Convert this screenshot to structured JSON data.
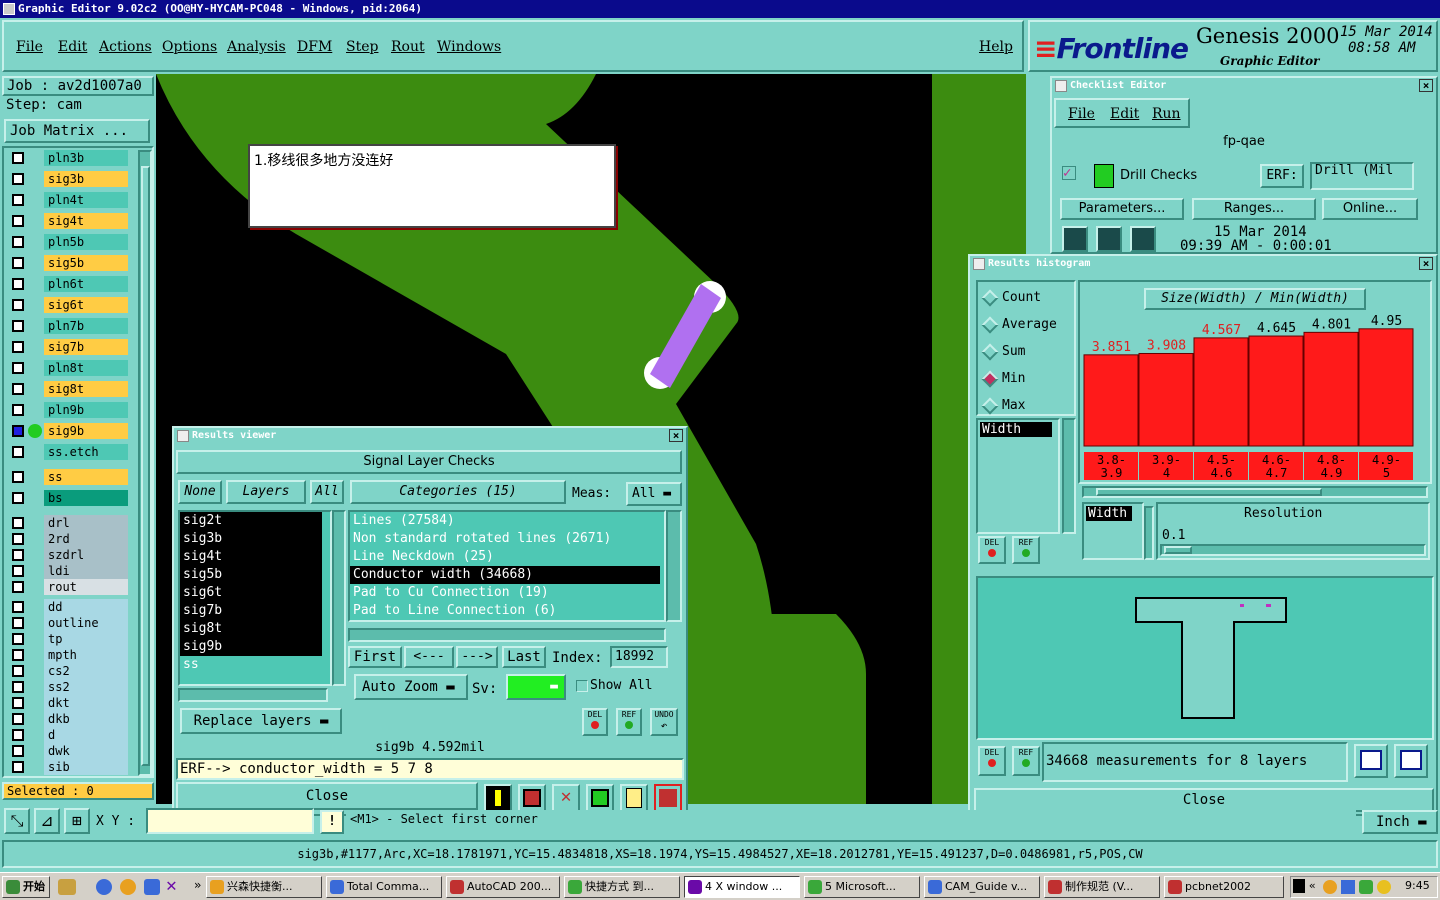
{
  "window_title": "Graphic Editor 9.02c2 (OO@HY-HYCAM-PC048 - Windows, pid:2064)",
  "menu": {
    "file": "File",
    "edit": "Edit",
    "actions": "Actions",
    "options": "Options",
    "analysis": "Analysis",
    "dfm": "DFM",
    "step": "Step",
    "rout": "Rout",
    "windows": "Windows",
    "help": "Help"
  },
  "brand": {
    "logo": "Frontline",
    "product": "Genesis 2000",
    "subtitle": "Graphic Editor",
    "date": "15 Mar 2014",
    "time": "08:58 AM"
  },
  "job": {
    "job_label": "Job : av2d1007a0",
    "step_label": "Step: cam",
    "matrix_button": "Job Matrix ..."
  },
  "layers": [
    {
      "name": "pln3b",
      "color": "#4ec8b4"
    },
    {
      "name": "sig3b",
      "color": "#ffcc44"
    },
    {
      "name": "pln4t",
      "color": "#4ec8b4"
    },
    {
      "name": "sig4t",
      "color": "#ffcc44"
    },
    {
      "name": "pln5b",
      "color": "#4ec8b4"
    },
    {
      "name": "sig5b",
      "color": "#ffcc44"
    },
    {
      "name": "pln6t",
      "color": "#4ec8b4"
    },
    {
      "name": "sig6t",
      "color": "#ffcc44"
    },
    {
      "name": "pln7b",
      "color": "#4ec8b4"
    },
    {
      "name": "sig7b",
      "color": "#ffcc44"
    },
    {
      "name": "pln8t",
      "color": "#4ec8b4"
    },
    {
      "name": "sig8t",
      "color": "#ffcc44"
    },
    {
      "name": "pln9b",
      "color": "#4ec8b4"
    },
    {
      "name": "sig9b",
      "color": "#ffcc44"
    },
    {
      "name": "ss.etch",
      "color": "#4ec8b4"
    },
    {
      "name": "ss",
      "color": "#ffcc44"
    },
    {
      "name": "bs",
      "color": "#0a9c7c"
    },
    {
      "name": "drl",
      "color": "#a8c0c8"
    },
    {
      "name": "2rd",
      "color": "#a8c0c8"
    },
    {
      "name": "szdrl",
      "color": "#a8c0c8"
    },
    {
      "name": "ldi",
      "color": "#a8c0c8"
    },
    {
      "name": "rout",
      "color": "#d8e0e4"
    },
    {
      "name": "dd",
      "color": "#a8d8e4"
    },
    {
      "name": "outline",
      "color": "#a8d8e4"
    },
    {
      "name": "tp",
      "color": "#a8d8e4"
    },
    {
      "name": "mpth",
      "color": "#a8d8e4"
    },
    {
      "name": "cs2",
      "color": "#a8d8e4"
    },
    {
      "name": "ss2",
      "color": "#a8d8e4"
    },
    {
      "name": "dkt",
      "color": "#a8d8e4"
    },
    {
      "name": "dkb",
      "color": "#a8d8e4"
    },
    {
      "name": "d",
      "color": "#a8d8e4"
    },
    {
      "name": "dwk",
      "color": "#a8d8e4"
    },
    {
      "name": "sib",
      "color": "#a8d8e4"
    }
  ],
  "selected_label": "Selected : 0",
  "annotation_note": "1.移线很多地方没连好",
  "results_viewer": {
    "title": "Results viewer",
    "header": "Signal Layer Checks",
    "none_btn": "None",
    "layers_btn": "Layers",
    "all_btn": "All",
    "categories_btn": "Categories (15)",
    "meas_label": "Meas:",
    "meas_value": "All",
    "layer_list": [
      "sig2t",
      "sig3b",
      "sig4t",
      "sig5b",
      "sig6t",
      "sig7b",
      "sig8t",
      "sig9b",
      "ss"
    ],
    "categories": [
      "Lines (27584)",
      "Non standard rotated lines (2671)",
      "Line Neckdown (25)",
      "Conductor width (34668)",
      "Pad to Cu Connection (19)",
      "Pad to Line Connection (6)"
    ],
    "first_btn": "First",
    "prev_btn": "<---",
    "next_btn": "--->",
    "last_btn": "Last",
    "index_label": "Index:",
    "index_value": "18992",
    "auto_zoom": "Auto Zoom",
    "sv_label": "Sv:",
    "show_all": "Show All",
    "replace_layers": "Replace layers",
    "del": "DEL",
    "ref": "REF",
    "undo": "UNDO",
    "status": "sig9b 4.592mil",
    "erf_line": "ERF--> conductor_width = 5 7 8",
    "close": "Close"
  },
  "checklist_editor": {
    "title": "Checklist Editor",
    "file": "File",
    "edit": "Edit",
    "run": "Run",
    "name": "fp-qae",
    "check_name": "Drill Checks",
    "erf_label": "ERF:",
    "erf_value": "Drill (Mil",
    "parameters": "Parameters...",
    "ranges": "Ranges...",
    "online": "Online...",
    "date": "15 Mar 2014",
    "time": "09:39 AM - 0:00:01"
  },
  "histogram": {
    "title": "Results histogram",
    "options": [
      "Count",
      "Average",
      "Sum",
      "Min",
      "Max"
    ],
    "selected_option": "Min",
    "list_item": "Width",
    "chart_title": "Size(Width) / Min(Width)",
    "resolution_label": "Resolution",
    "resolution_value": "0.1",
    "width_label": "Width",
    "summary": "34668 measurements for 8 layers",
    "close": "Close",
    "del": "DEL",
    "ref": "REF"
  },
  "chart_data": {
    "type": "bar",
    "categories": [
      "3.8-3.9",
      "3.9-4",
      "4.5-4.6",
      "4.6-4.7",
      "4.8-4.9",
      "4.9-5"
    ],
    "category_lines": [
      [
        "3.8-",
        "3.9"
      ],
      [
        "3.9-",
        "4"
      ],
      [
        "4.5-",
        "4.6"
      ],
      [
        "4.6-",
        "4.7"
      ],
      [
        "4.8-",
        "4.9"
      ],
      [
        "4.9-",
        "5"
      ]
    ],
    "values": [
      3.851,
      3.908,
      4.567,
      4.645,
      4.801,
      4.95
    ],
    "label_colors": [
      "#e02020",
      "#e02020",
      "#e02020",
      "#000000",
      "#000000",
      "#000000"
    ],
    "title": "Size(Width) / Min(Width)",
    "ylim": [
      0,
      5.5
    ]
  },
  "bottom": {
    "xy_label": "X Y :",
    "prompt": "<M1> - Select first corner",
    "units": "Inch",
    "feature_info": "sig3b,#1177,Arc,XC=18.1781971,YC=15.4834818,XS=18.1974,YS=15.4984527,XE=18.2012781,YE=15.491237,D=0.0486981,r5,POS,CW"
  },
  "taskbar": {
    "start": "开始",
    "items": [
      "兴森快捷衡...",
      "Total Comma...",
      "AutoCAD 200...",
      "快捷方式 到...",
      "4 X window ...",
      "5 Microsoft...",
      "CAM_Guide v...",
      "制作规范 (V...",
      "pcbnet2002"
    ],
    "clock": "9:45"
  }
}
